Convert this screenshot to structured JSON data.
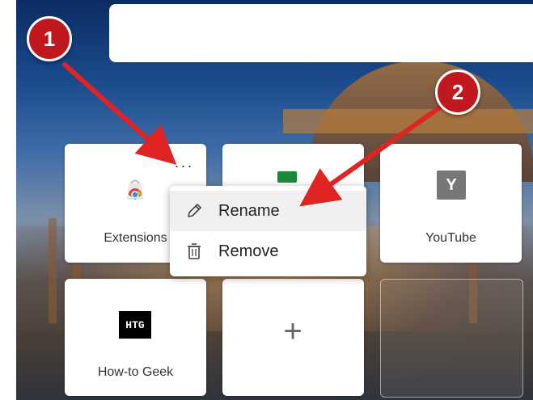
{
  "tiles": [
    {
      "label": "Extensions",
      "icon": "chrome-web-store-icon"
    },
    {
      "label": "",
      "icon": "green-site-icon"
    },
    {
      "label": "YouTube",
      "icon": "youtube-y-icon",
      "glyph": "Y"
    },
    {
      "label": "How-to Geek",
      "icon": "htg-icon",
      "glyph": "HTG"
    },
    {
      "label": "",
      "icon": "plus-icon",
      "glyph": "+"
    }
  ],
  "more_button": {
    "glyph": "..."
  },
  "context_menu": {
    "items": [
      {
        "label": "Rename",
        "icon": "pencil-icon"
      },
      {
        "label": "Remove",
        "icon": "trash-icon"
      }
    ]
  },
  "markers": [
    "1",
    "2"
  ],
  "colors": {
    "marker": "#c0181e",
    "youtube_tile": "#777777",
    "htg_tile": "#000000",
    "green_site": "#1a8a3a"
  }
}
